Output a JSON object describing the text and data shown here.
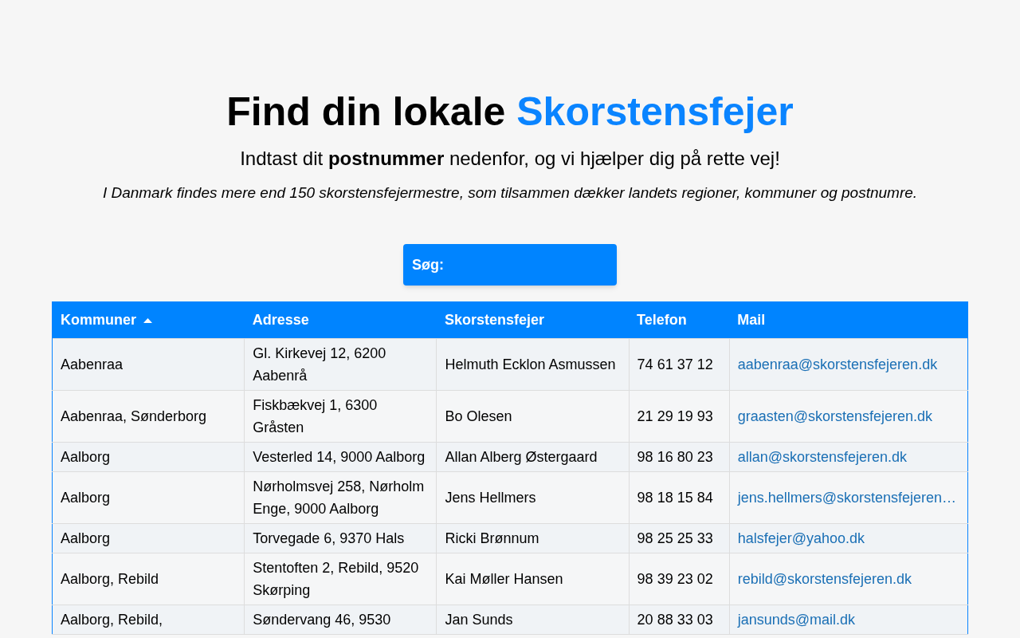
{
  "heading": {
    "text": "Find din lokale",
    "highlight": "Skorstensfejer"
  },
  "subtitle": "Indtast dit **postnummer** nedenfor, og vi hjælper dig på rette vej!",
  "note": "I Danmark findes mere end 150 skorstensfejermestre, som tilsammen dækker landets regioner, kommuner og postnumre.",
  "search": {
    "label": "Søg:"
  },
  "table": {
    "columns": [
      {
        "label": "Kommuner",
        "sorted": true
      },
      {
        "label": "Adresse",
        "sorted": false
      },
      {
        "label": "Skorstensfejer",
        "sorted": false
      },
      {
        "label": "Telefon",
        "sorted": false
      },
      {
        "label": "Mail",
        "sorted": false
      }
    ],
    "rows": [
      [
        "Aabenraa",
        "Gl. Kirkevej 12, 6200 Aabenrå",
        "Helmuth Ecklon Asmussen",
        "74 61 37 12",
        "aabenraa@skorstensfejeren.dk"
      ],
      [
        "Aabenraa, Sønderborg",
        "Fiskbækvej 1, 6300 Gråsten",
        "Bo Olesen",
        "21 29 19 93",
        "graasten@skorstensfejeren.dk"
      ],
      [
        "Aalborg",
        "Vesterled 14, 9000 Aalborg",
        "Allan Alberg Østergaard",
        "98 16 80 23",
        "allan@skorstensfejeren.dk"
      ],
      [
        "Aalborg",
        "Nørholmsvej 258, Nørholm Enge, 9000 Aalborg",
        "Jens Hellmers",
        "98 18 15 84",
        "jens.hellmers@skorstensfejeren…"
      ],
      [
        "Aalborg",
        "Torvegade 6, 9370 Hals",
        "Ricki Brønnum",
        "98 25 25 33",
        "halsfejer@yahoo.dk"
      ],
      [
        "Aalborg, Rebild",
        "Stentoften 2, Rebild, 9520 Skørping",
        "Kai Møller Hansen",
        "98 39 23 02",
        "rebild@skorstensfejeren.dk"
      ],
      [
        "Aalborg, Rebild,",
        "Søndervang 46, 9530",
        "Jan Sunds",
        "20 88 33 03",
        "jansunds@mail.dk"
      ]
    ]
  }
}
